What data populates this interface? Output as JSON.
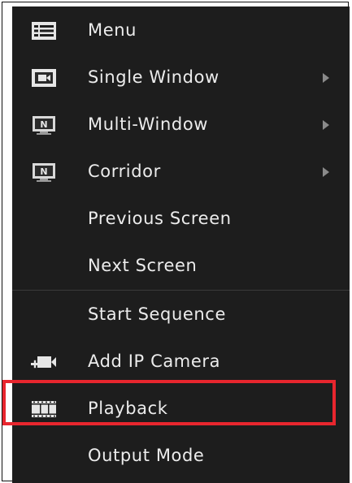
{
  "menu": {
    "items": [
      {
        "label": "Menu",
        "icon": "list-icon",
        "submenu": false
      },
      {
        "label": "Single Window",
        "icon": "single-window-icon",
        "submenu": true
      },
      {
        "label": "Multi-Window",
        "icon": "multi-window-icon",
        "submenu": true
      },
      {
        "label": "Corridor",
        "icon": "corridor-icon",
        "submenu": true
      },
      {
        "label": "Previous Screen",
        "icon": "",
        "submenu": false
      },
      {
        "label": "Next Screen",
        "icon": "",
        "submenu": false
      },
      {
        "label": "Start Sequence",
        "icon": "",
        "submenu": false
      },
      {
        "label": "Add IP Camera",
        "icon": "add-camera-icon",
        "submenu": false
      },
      {
        "label": "Playback",
        "icon": "film-icon",
        "submenu": false,
        "highlighted": true
      },
      {
        "label": "Output Mode",
        "icon": "",
        "submenu": false
      }
    ]
  },
  "colors": {
    "background": "#1d1d1d",
    "text": "#ececec",
    "highlight_border": "#e8262e",
    "arrow": "#8a8a8a"
  }
}
